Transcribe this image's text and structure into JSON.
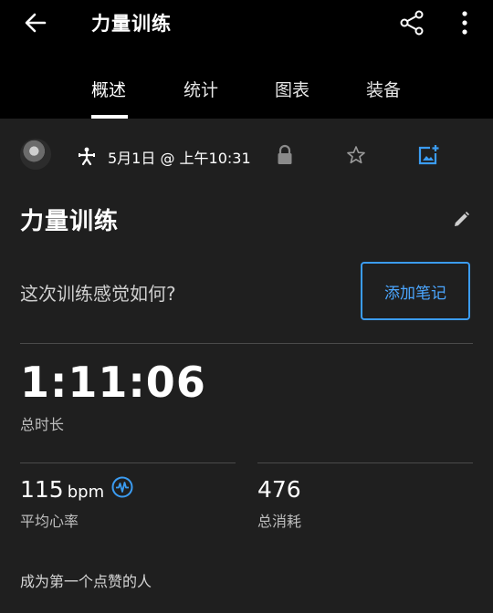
{
  "header": {
    "title": "力量训练",
    "icons": {
      "back": "arrow-left-icon",
      "share": "share-icon",
      "more": "more-vertical-icon"
    }
  },
  "tabs": [
    {
      "label": "概述",
      "active": true
    },
    {
      "label": "统计",
      "active": false
    },
    {
      "label": "图表",
      "active": false
    },
    {
      "label": "装备",
      "active": false
    }
  ],
  "activity": {
    "date": "5月1日 @ 上午10:31",
    "title": "力量训练",
    "icons": {
      "type": "strength-training-icon",
      "privacy": "lock-icon",
      "favorite": "star-outline-icon",
      "photo": "add-photo-icon",
      "edit": "pencil-icon"
    }
  },
  "feedback": {
    "question": "这次训练感觉如何?",
    "add_note_label": "添加笔记"
  },
  "stats": {
    "duration_value": "1:11:06",
    "duration_label": "总时长",
    "hr_value": "115",
    "hr_unit": "bpm",
    "hr_label": "平均心率",
    "calories_value": "476",
    "calories_label": "总消耗"
  },
  "social": {
    "like_text": "成为第一个点赞的人"
  },
  "colors": {
    "background": "#1f1f1f",
    "topbar": "#000000",
    "accent_blue": "#3b9cf2",
    "divider": "#4a4a4a"
  }
}
